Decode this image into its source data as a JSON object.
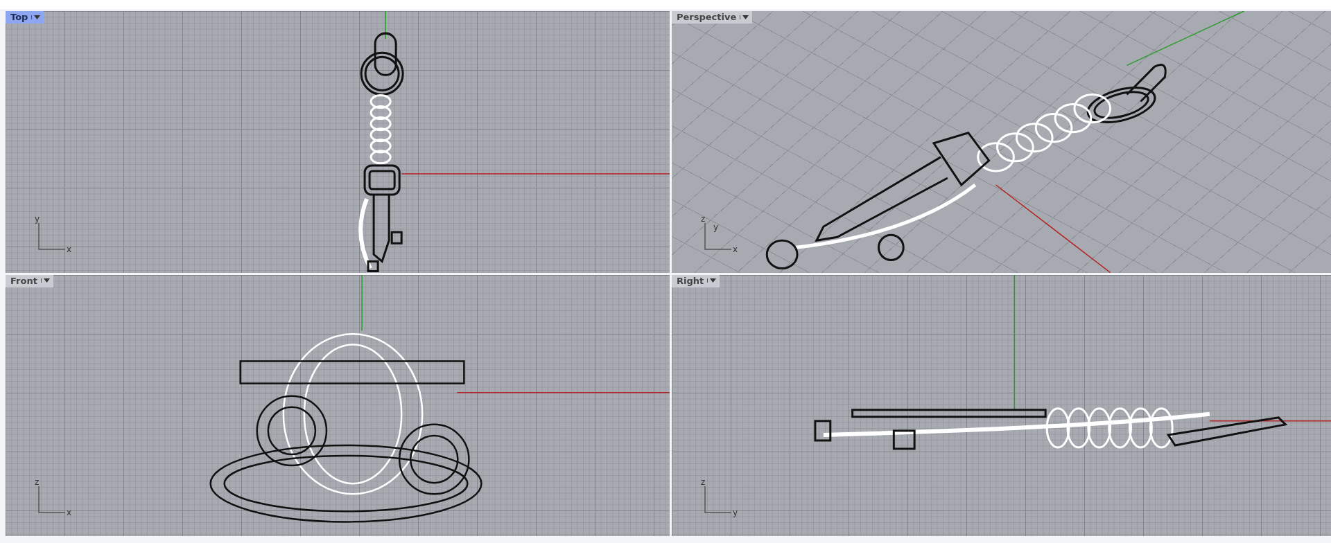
{
  "viewports": [
    {
      "title": "Top",
      "selected": true,
      "kind": "top",
      "axes": {
        "up": "y",
        "right": "x"
      }
    },
    {
      "title": "Perspective",
      "selected": false,
      "kind": "perspective",
      "axes": {
        "up": "z",
        "mid": "y",
        "right": "x"
      }
    },
    {
      "title": "Front",
      "selected": false,
      "kind": "front",
      "axes": {
        "up": "z",
        "right": "x"
      }
    },
    {
      "title": "Right",
      "selected": false,
      "kind": "right",
      "axes": {
        "up": "z",
        "right": "y"
      }
    }
  ]
}
